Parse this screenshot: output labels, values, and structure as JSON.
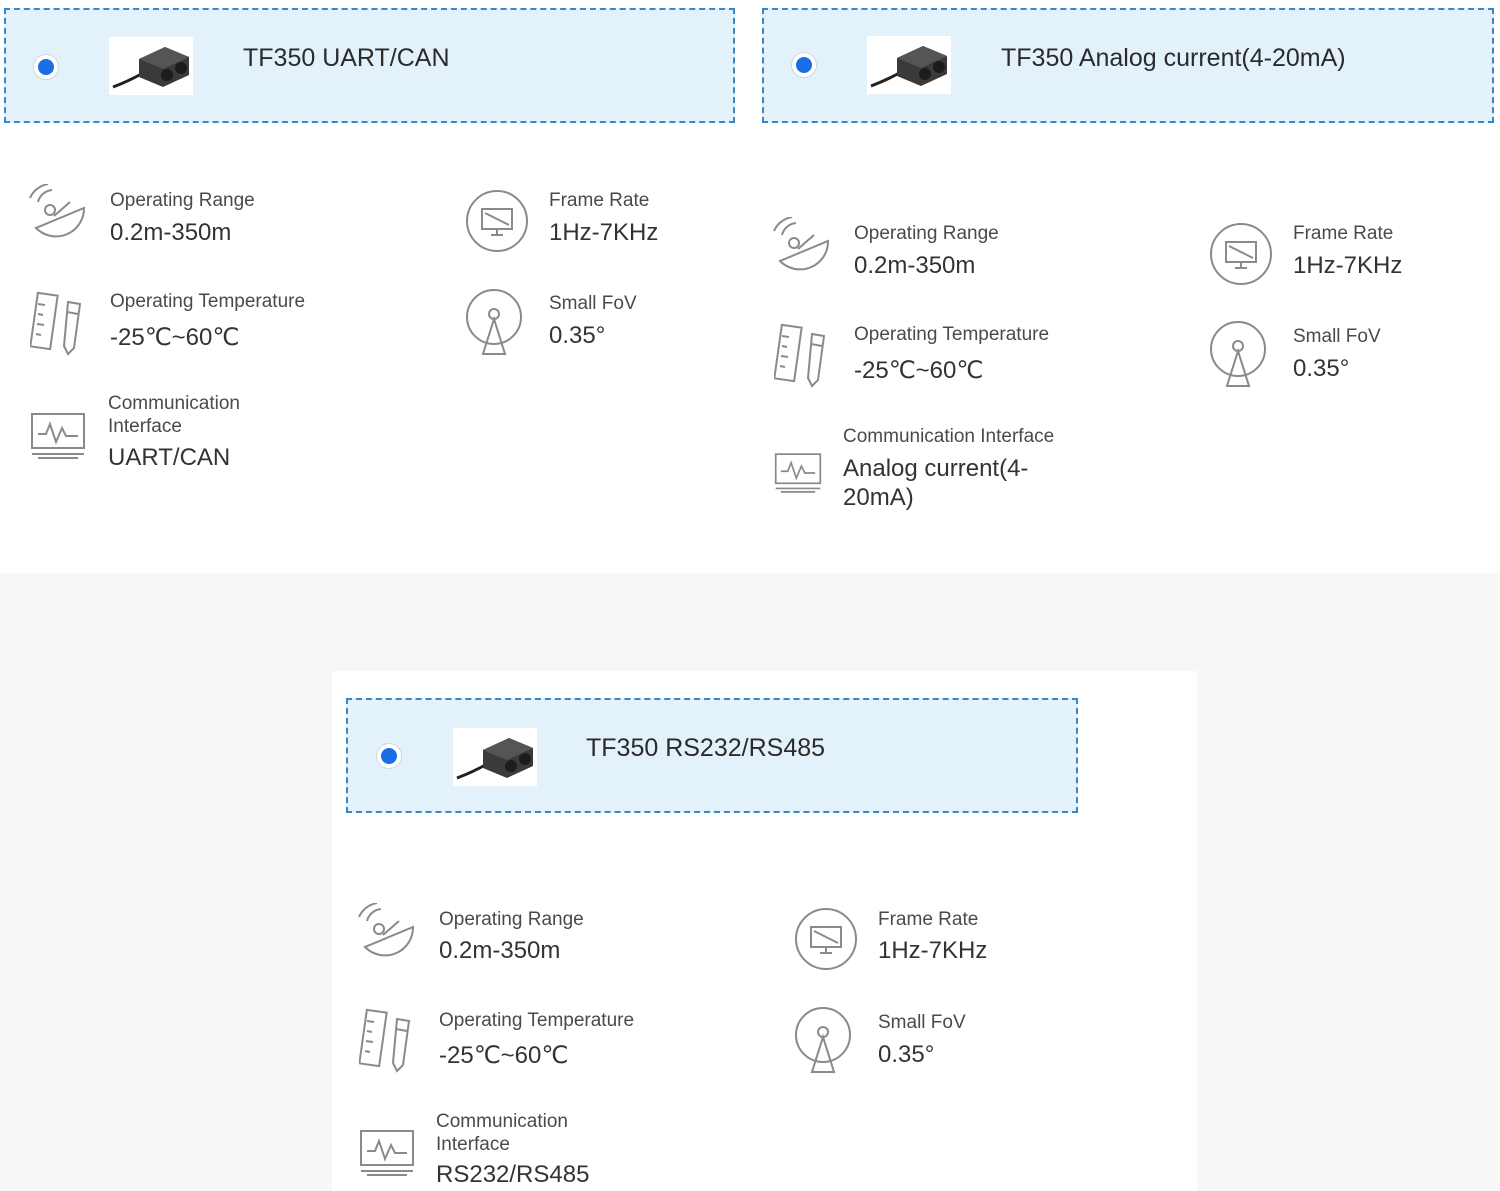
{
  "panels": [
    {
      "title": "TF350 UART/CAN",
      "specs": {
        "range_label": "Operating Range",
        "range_value": "0.2m-350m",
        "frame_label": "Frame Rate",
        "frame_value": "1Hz-7KHz",
        "temp_label": "Operating Temperature",
        "temp_value": "-25℃~60℃",
        "fov_label": "Small FoV",
        "fov_value": "0.35°",
        "comm_label_1": "Communication",
        "comm_label_2": "Interface",
        "comm_value_1": "UART/CAN"
      }
    },
    {
      "title": "TF350 Analog current(4-20mA)",
      "specs": {
        "range_label": "Operating Range",
        "range_value": "0.2m-350m",
        "frame_label": "Frame Rate",
        "frame_value": "1Hz-7KHz",
        "temp_label": "Operating Temperature",
        "temp_value": "-25℃~60℃",
        "fov_label": "Small FoV",
        "fov_value": "0.35°",
        "comm_label_1": "Communication Interface",
        "comm_value_1": "Analog current(4-",
        "comm_value_2": "20mA)"
      }
    },
    {
      "title": "TF350 RS232/RS485",
      "specs": {
        "range_label": "Operating Range",
        "range_value": "0.2m-350m",
        "frame_label": "Frame Rate",
        "frame_value": "1Hz-7KHz",
        "temp_label": "Operating Temperature",
        "temp_value": "-25℃~60℃",
        "fov_label": "Small FoV",
        "fov_value": "0.35°",
        "comm_label_1": "Communication",
        "comm_label_2": "Interface",
        "comm_value_1": "RS232/RS485"
      }
    }
  ],
  "icons": {
    "radio": "radio-selected-icon",
    "product": "lidar-sensor-image",
    "range": "satellite-dish-icon",
    "frame": "monitor-icon",
    "temp": "ruler-pencil-icon",
    "fov": "radar-cone-icon",
    "comm": "waveform-monitor-icon"
  },
  "colors": {
    "accent": "#1b6fe6",
    "option_bg": "#e3f2fa",
    "option_border": "#3c86c8"
  }
}
